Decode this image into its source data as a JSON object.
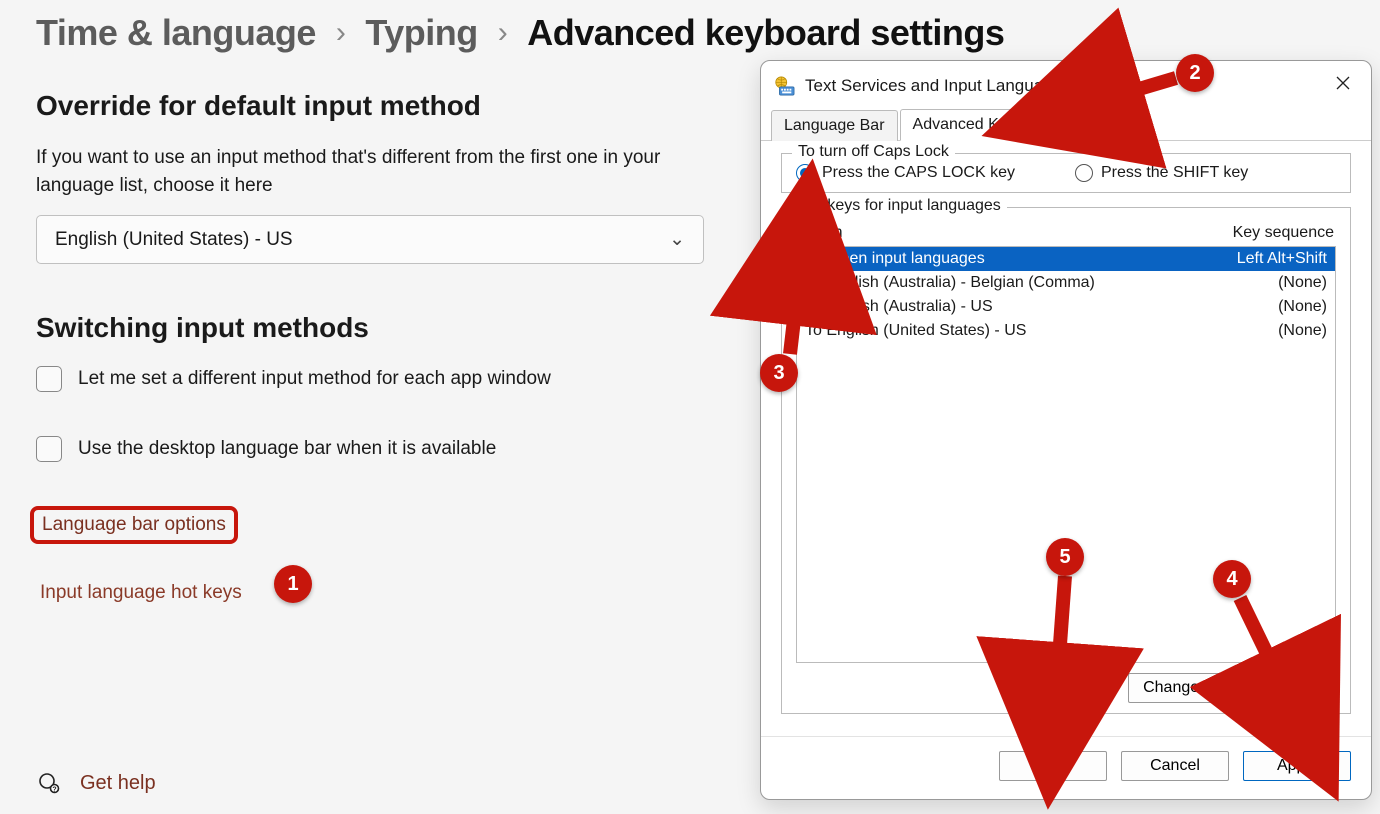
{
  "breadcrumb": {
    "time_lang": "Time & language",
    "typing": "Typing",
    "current": "Advanced keyboard settings"
  },
  "override": {
    "heading": "Override for default input method",
    "desc": "If you want to use an input method that's different from the first one in your language list, choose it here",
    "selected": "English (United States) - US"
  },
  "switching": {
    "heading": "Switching input methods",
    "chk_per_app": "Let me set a different input method for each app window",
    "chk_desktop_bar": "Use the desktop language bar when it is available",
    "link_lang_bar": "Language bar options",
    "link_hotkeys": "Input language hot keys"
  },
  "help": {
    "label": "Get help"
  },
  "dialog": {
    "title": "Text Services and Input Languages",
    "tabs": {
      "lang_bar": "Language Bar",
      "adv_key": "Advanced Key Settings"
    },
    "capslock": {
      "legend": "To turn off Caps Lock",
      "opt_caps": "Press the CAPS LOCK key",
      "opt_shift": "Press the SHIFT key"
    },
    "hotkeys": {
      "legend": "Hot keys for input languages",
      "col_action": "Action",
      "col_seq": "Key sequence",
      "rows": [
        {
          "action": "Between input languages",
          "seq": "Left Alt+Shift",
          "selected": true
        },
        {
          "action": "To English (Australia) - Belgian (Comma)",
          "seq": "(None)"
        },
        {
          "action": "To English (Australia) - US",
          "seq": "(None)"
        },
        {
          "action": "To English (United States) - US",
          "seq": "(None)"
        }
      ],
      "change_btn": "Change Key Sequence..."
    },
    "buttons": {
      "ok": "OK",
      "cancel": "Cancel",
      "apply": "Apply"
    }
  },
  "annotations": {
    "b1": "1",
    "b2": "2",
    "b3": "3",
    "b4": "4",
    "b5": "5"
  }
}
